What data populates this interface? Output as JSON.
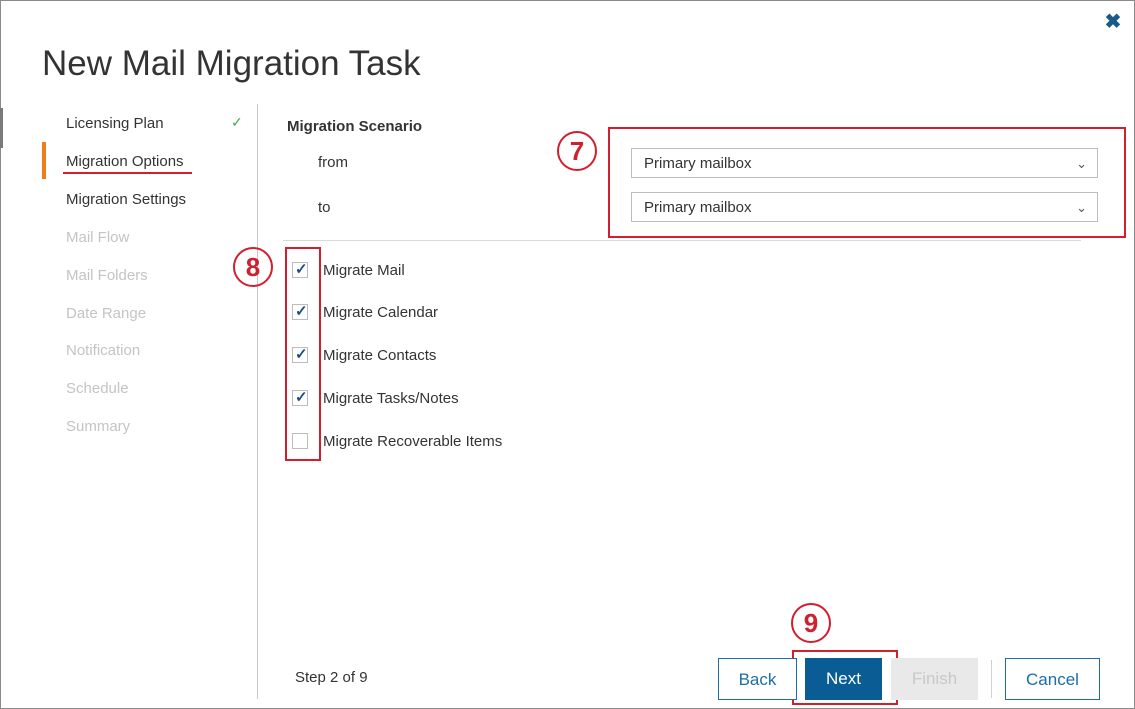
{
  "dialog": {
    "title": "New Mail Migration Task",
    "close_icon": "close-icon",
    "accent_color": "#f07c1b",
    "annotation_color": "#d01f2f"
  },
  "nav": {
    "items": [
      {
        "label": "Licensing Plan",
        "state": "done"
      },
      {
        "label": "Migration Options",
        "state": "active"
      },
      {
        "label": "Migration Settings",
        "state": "enabled"
      },
      {
        "label": "Mail Flow",
        "state": "disabled"
      },
      {
        "label": "Mail Folders",
        "state": "disabled"
      },
      {
        "label": "Date Range",
        "state": "disabled"
      },
      {
        "label": "Notification",
        "state": "disabled"
      },
      {
        "label": "Schedule",
        "state": "disabled"
      },
      {
        "label": "Summary",
        "state": "disabled"
      }
    ]
  },
  "scenario": {
    "heading": "Migration Scenario",
    "from_label": "from",
    "to_label": "to",
    "from_value": "Primary mailbox",
    "to_value": "Primary mailbox"
  },
  "options": [
    {
      "label": "Migrate Mail",
      "checked": true
    },
    {
      "label": "Migrate Calendar",
      "checked": true
    },
    {
      "label": "Migrate Contacts",
      "checked": true
    },
    {
      "label": "Migrate Tasks/Notes",
      "checked": true
    },
    {
      "label": "Migrate Recoverable Items",
      "checked": false
    }
  ],
  "annotations": [
    "7",
    "8",
    "9"
  ],
  "footer": {
    "step_text": "Step 2 of 9",
    "back_label": "Back",
    "next_label": "Next",
    "finish_label": "Finish",
    "cancel_label": "Cancel"
  }
}
